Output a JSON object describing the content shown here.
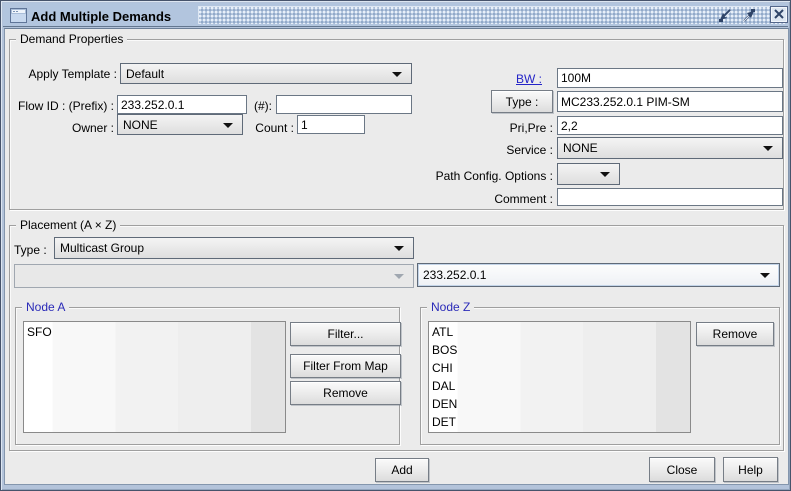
{
  "window": {
    "title": "Add Multiple Demands",
    "icons": {
      "app": "window-icon",
      "minimize": "minimize-arrow-icon",
      "maximize": "maximize-arrow-icon",
      "close": "close-x-icon"
    }
  },
  "demand": {
    "group_title": "Demand Properties",
    "apply_template_label": "Apply Template :",
    "apply_template_value": "Default",
    "flow_id_label": "Flow ID : (Prefix) :",
    "flow_prefix_value": "233.252.0.1",
    "flow_num_label": "(#):",
    "flow_num_value": "",
    "owner_label": "Owner :",
    "owner_value": "NONE",
    "count_label": "Count :",
    "count_value": "1",
    "bw_label": "BW :",
    "bw_value": "100M",
    "type_button_label": "Type :",
    "type_value": "MC233.252.0.1 PIM-SM",
    "pripre_label": "Pri,Pre :",
    "pripre_value": "2,2",
    "service_label": "Service :",
    "service_value": "NONE",
    "path_config_label": "Path Config. Options :",
    "path_config_value": "",
    "comment_label": "Comment :",
    "comment_value": ""
  },
  "placement": {
    "group_title": "Placement (A × Z)",
    "type_label": "Type :",
    "type_value": "Multicast Group",
    "secondary_combo_value": "",
    "multicast_group_value": "233.252.0.1",
    "node_a": {
      "group_title": "Node A",
      "items": [
        "SFO"
      ],
      "filter_button": "Filter...",
      "filter_from_map_button": "Filter From Map",
      "remove_button": "Remove"
    },
    "node_z": {
      "group_title": "Node Z",
      "items": [
        "ATL",
        "BOS",
        "CHI",
        "DAL",
        "DEN",
        "DET"
      ],
      "remove_button": "Remove"
    }
  },
  "footer": {
    "add_button": "Add",
    "close_button": "Close",
    "help_button": "Help"
  },
  "colors": {
    "titlebar": "#b2c5de",
    "background": "#ebebeb",
    "blue_label": "#2424c8",
    "group_title_blue": "#2a2ab8",
    "frame_border": "#46536b"
  }
}
